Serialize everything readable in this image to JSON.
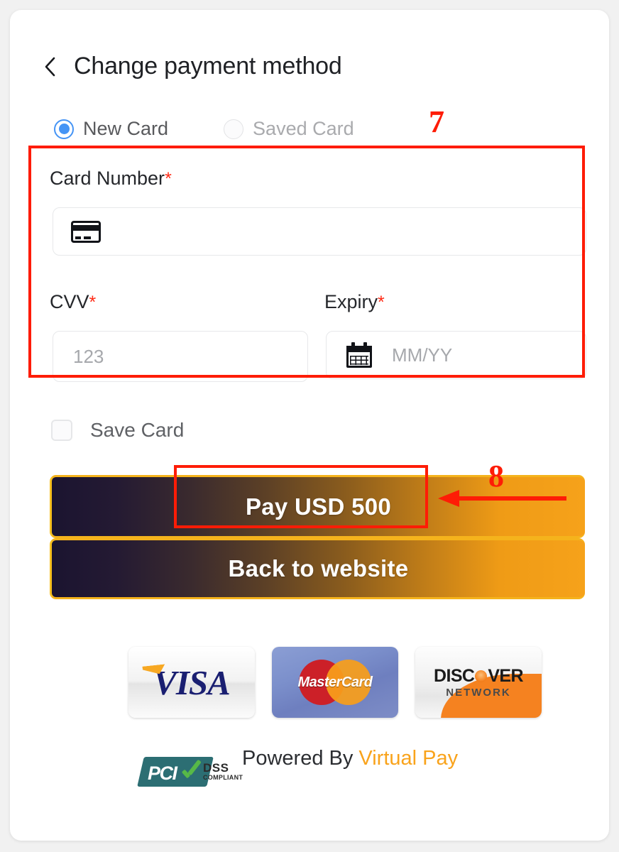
{
  "header": {
    "back_icon": "chevron-left-icon",
    "title": "Change payment method"
  },
  "payment_type": {
    "options": [
      {
        "label": "New Card",
        "selected": true
      },
      {
        "label": "Saved Card",
        "selected": false
      }
    ]
  },
  "form": {
    "card_number": {
      "label": "Card Number",
      "required_mark": "*",
      "icon": "credit-card-icon",
      "value": "",
      "placeholder": ""
    },
    "cvv": {
      "label": "CVV",
      "required_mark": "*",
      "value": "",
      "placeholder": "123"
    },
    "expiry": {
      "label": "Expiry",
      "required_mark": "*",
      "icon": "calendar-icon",
      "value": "",
      "placeholder": "MM/YY"
    },
    "save_card": {
      "label": "Save Card",
      "checked": false
    }
  },
  "actions": {
    "pay_label": "Pay USD 500",
    "back_label": "Back to website"
  },
  "brands": [
    {
      "name": "visa",
      "text": "VISA"
    },
    {
      "name": "mastercard",
      "text": "MasterCard"
    },
    {
      "name": "discover",
      "text": "DISC",
      "text_tail": "VER",
      "subtext": "NETWORK"
    }
  ],
  "footer": {
    "pci": {
      "pci_text": "PCI",
      "dss_text": "DSS",
      "compliant_text": "COMPLIANT"
    },
    "powered_prefix": "Powered By ",
    "brand": "Virtual Pay"
  },
  "annotations": [
    {
      "id": "7",
      "label": "7",
      "target": "card-details-region"
    },
    {
      "id": "8",
      "label": "8",
      "target": "pay-button"
    }
  ],
  "colors": {
    "accent_blue": "#4594f5",
    "required_red": "#ff2a15",
    "annotation_red": "#fe1c06",
    "brand_orange": "#f9a31b",
    "button_gradient_start": "#1b1430",
    "button_gradient_end": "#f6a21a"
  }
}
